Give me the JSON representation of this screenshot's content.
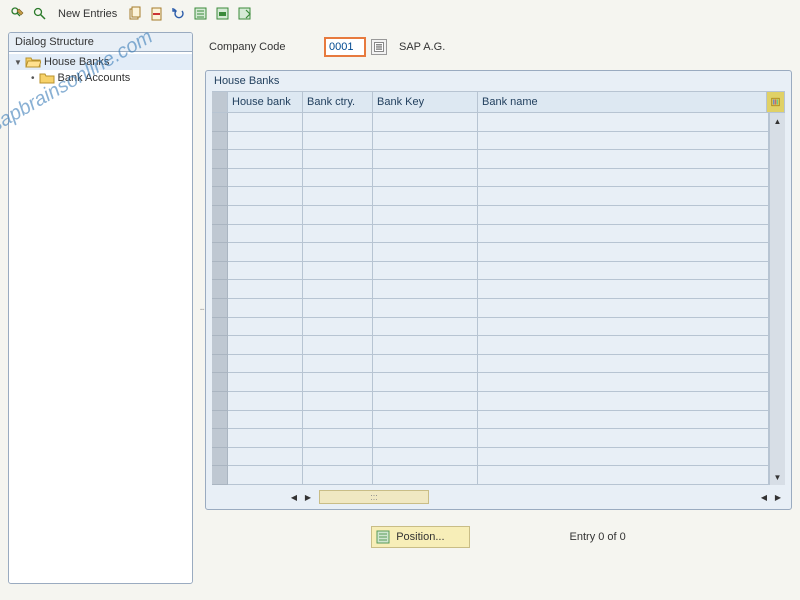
{
  "toolbar": {
    "new_entries_label": "New Entries"
  },
  "sidebar": {
    "header": "Dialog Structure",
    "items": [
      {
        "label": "House Banks",
        "expanded": true
      },
      {
        "label": "Bank Accounts",
        "expanded": false
      }
    ]
  },
  "field": {
    "company_code_label": "Company Code",
    "company_code_value": "0001",
    "company_name": "SAP A.G."
  },
  "table": {
    "title": "House Banks",
    "columns": [
      "House bank",
      "Bank ctry.",
      "Bank Key",
      "Bank name"
    ],
    "rows": 20
  },
  "hscroll": {
    "thumb_label": ":::"
  },
  "footer": {
    "position_label": "Position...",
    "entry_label": "Entry 0 of 0"
  },
  "watermark": "sapbrainsonline.com"
}
